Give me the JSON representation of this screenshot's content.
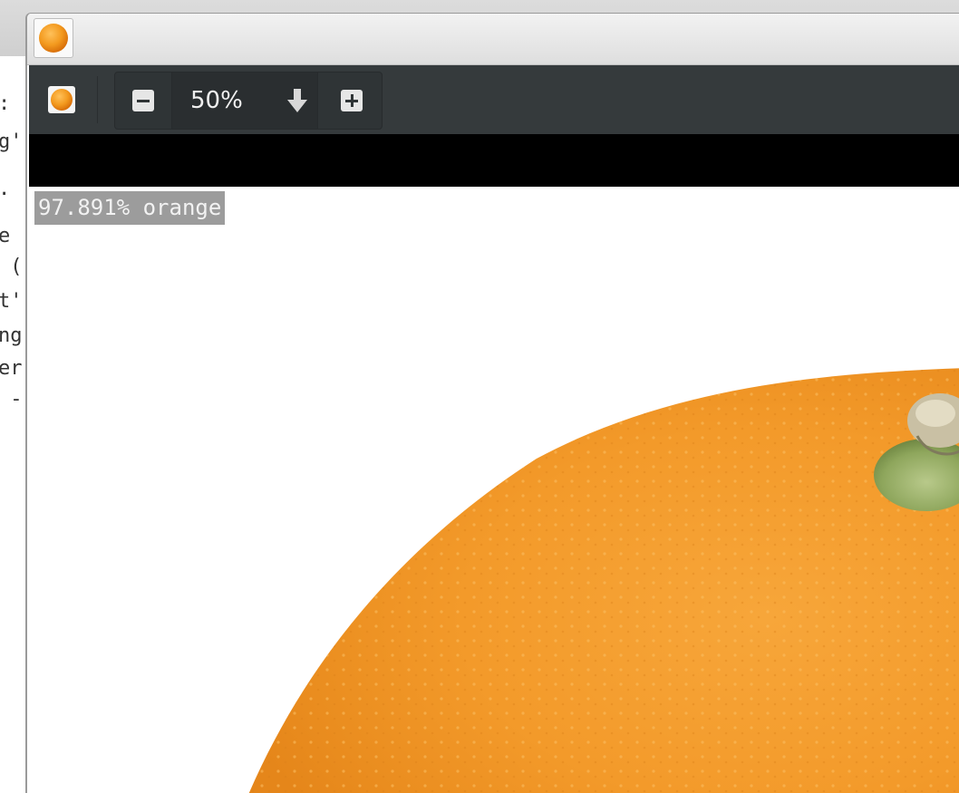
{
  "terminal": {
    "lines": [
      ":",
      "g'",
      ".",
      "",
      "e",
      " (",
      "t'",
      "ng",
      "er",
      " -"
    ]
  },
  "window": {
    "app_icon": "orange-icon"
  },
  "toolbar": {
    "app_icon": "orange-icon",
    "zoom_out_icon": "minus-icon",
    "zoom_value": "50%",
    "zoom_dropdown_icon": "arrow-down-icon",
    "zoom_in_icon": "plus-icon"
  },
  "image": {
    "label": "97.891% orange",
    "subject": "orange"
  },
  "colors": {
    "toolbar_bg": "#353a3c",
    "orange": "#f49a2b",
    "label_bg": "#9c9c9c"
  }
}
